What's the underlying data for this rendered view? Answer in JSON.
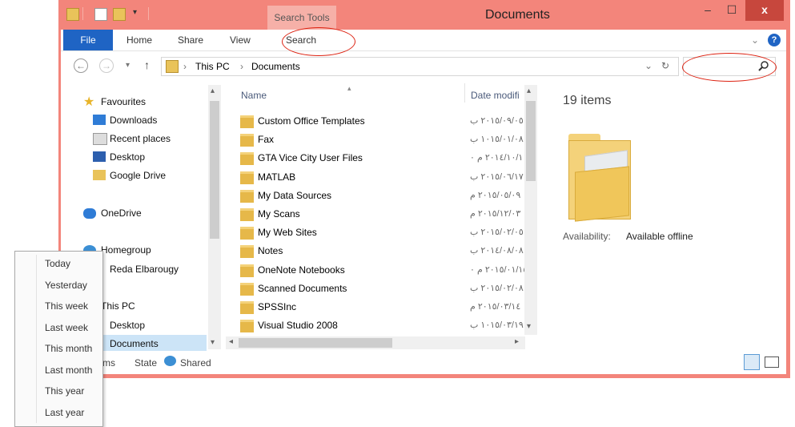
{
  "title_bar": {
    "title": "Documents",
    "search_tools": "Search Tools",
    "minimize": "–",
    "maximize": "☐",
    "close": "x"
  },
  "ribbon": {
    "tabs": [
      "File",
      "Home",
      "Share",
      "View",
      "Search"
    ],
    "expand": "⌄",
    "help": "?"
  },
  "address": {
    "back": "←",
    "forward": "→",
    "recent": "▾",
    "up": "↑",
    "path": [
      "This PC",
      "Documents"
    ],
    "sep": "›",
    "dropdown": "⌄",
    "refresh": "↻",
    "search_placeholder": "",
    "search_icon": "search-icon"
  },
  "nav_pane": {
    "favourites_label": "Favourites",
    "favourites": [
      "Downloads",
      "Recent places",
      "Desktop",
      "Google Drive"
    ],
    "onedrive": "OneDrive",
    "homegroup": "Homegroup",
    "homegroup_user": "Reda Elbarougy",
    "this_pc": "This PC",
    "pc_items": [
      "Desktop",
      "Documents"
    ]
  },
  "file_list": {
    "col_name": "Name",
    "col_date": "Date modifi",
    "rows": [
      {
        "name": "Custom Office Templates",
        "date": "٢٠١٥/٠٩/٠٥ ب"
      },
      {
        "name": "Fax",
        "date": "١٠١٥/٠١/٠٨ ب"
      },
      {
        "name": "GTA Vice City User Files",
        "date": "٢٠١٤/١٠/١١ م ٠"
      },
      {
        "name": "MATLAB",
        "date": "٢٠١٥/٠٦/١٧ ب"
      },
      {
        "name": "My Data Sources",
        "date": "٢٠١٥/٠٥/٠٩ م"
      },
      {
        "name": "My Scans",
        "date": "٢٠١٥/١٢/٠٣ م"
      },
      {
        "name": "My Web Sites",
        "date": "٢٠١٥/٠٢/٠٥ ب"
      },
      {
        "name": "Notes",
        "date": "٢٠١٤/٠٨/٠٨ ب"
      },
      {
        "name": "OneNote Notebooks",
        "date": "٢٠١٥/٠١/١٥ م ٠"
      },
      {
        "name": "Scanned Documents",
        "date": "٢٠١٥/٠٢/٠٨ ب"
      },
      {
        "name": "SPSSInc",
        "date": "٢٠١٥/٠٣/١٤ م"
      },
      {
        "name": "Visual Studio 2008",
        "date": "١٠١٥/٠٣/١٩ ب"
      }
    ]
  },
  "details": {
    "count": "19 items",
    "availability_label": "Availability:",
    "availability_value": "Available offline"
  },
  "status_bar": {
    "items_fragment": "ms",
    "state_label": "State",
    "shared": "Shared"
  },
  "date_menu": [
    "Today",
    "Yesterday",
    "This week",
    "Last week",
    "This month",
    "Last month",
    "This year",
    "Last year"
  ]
}
